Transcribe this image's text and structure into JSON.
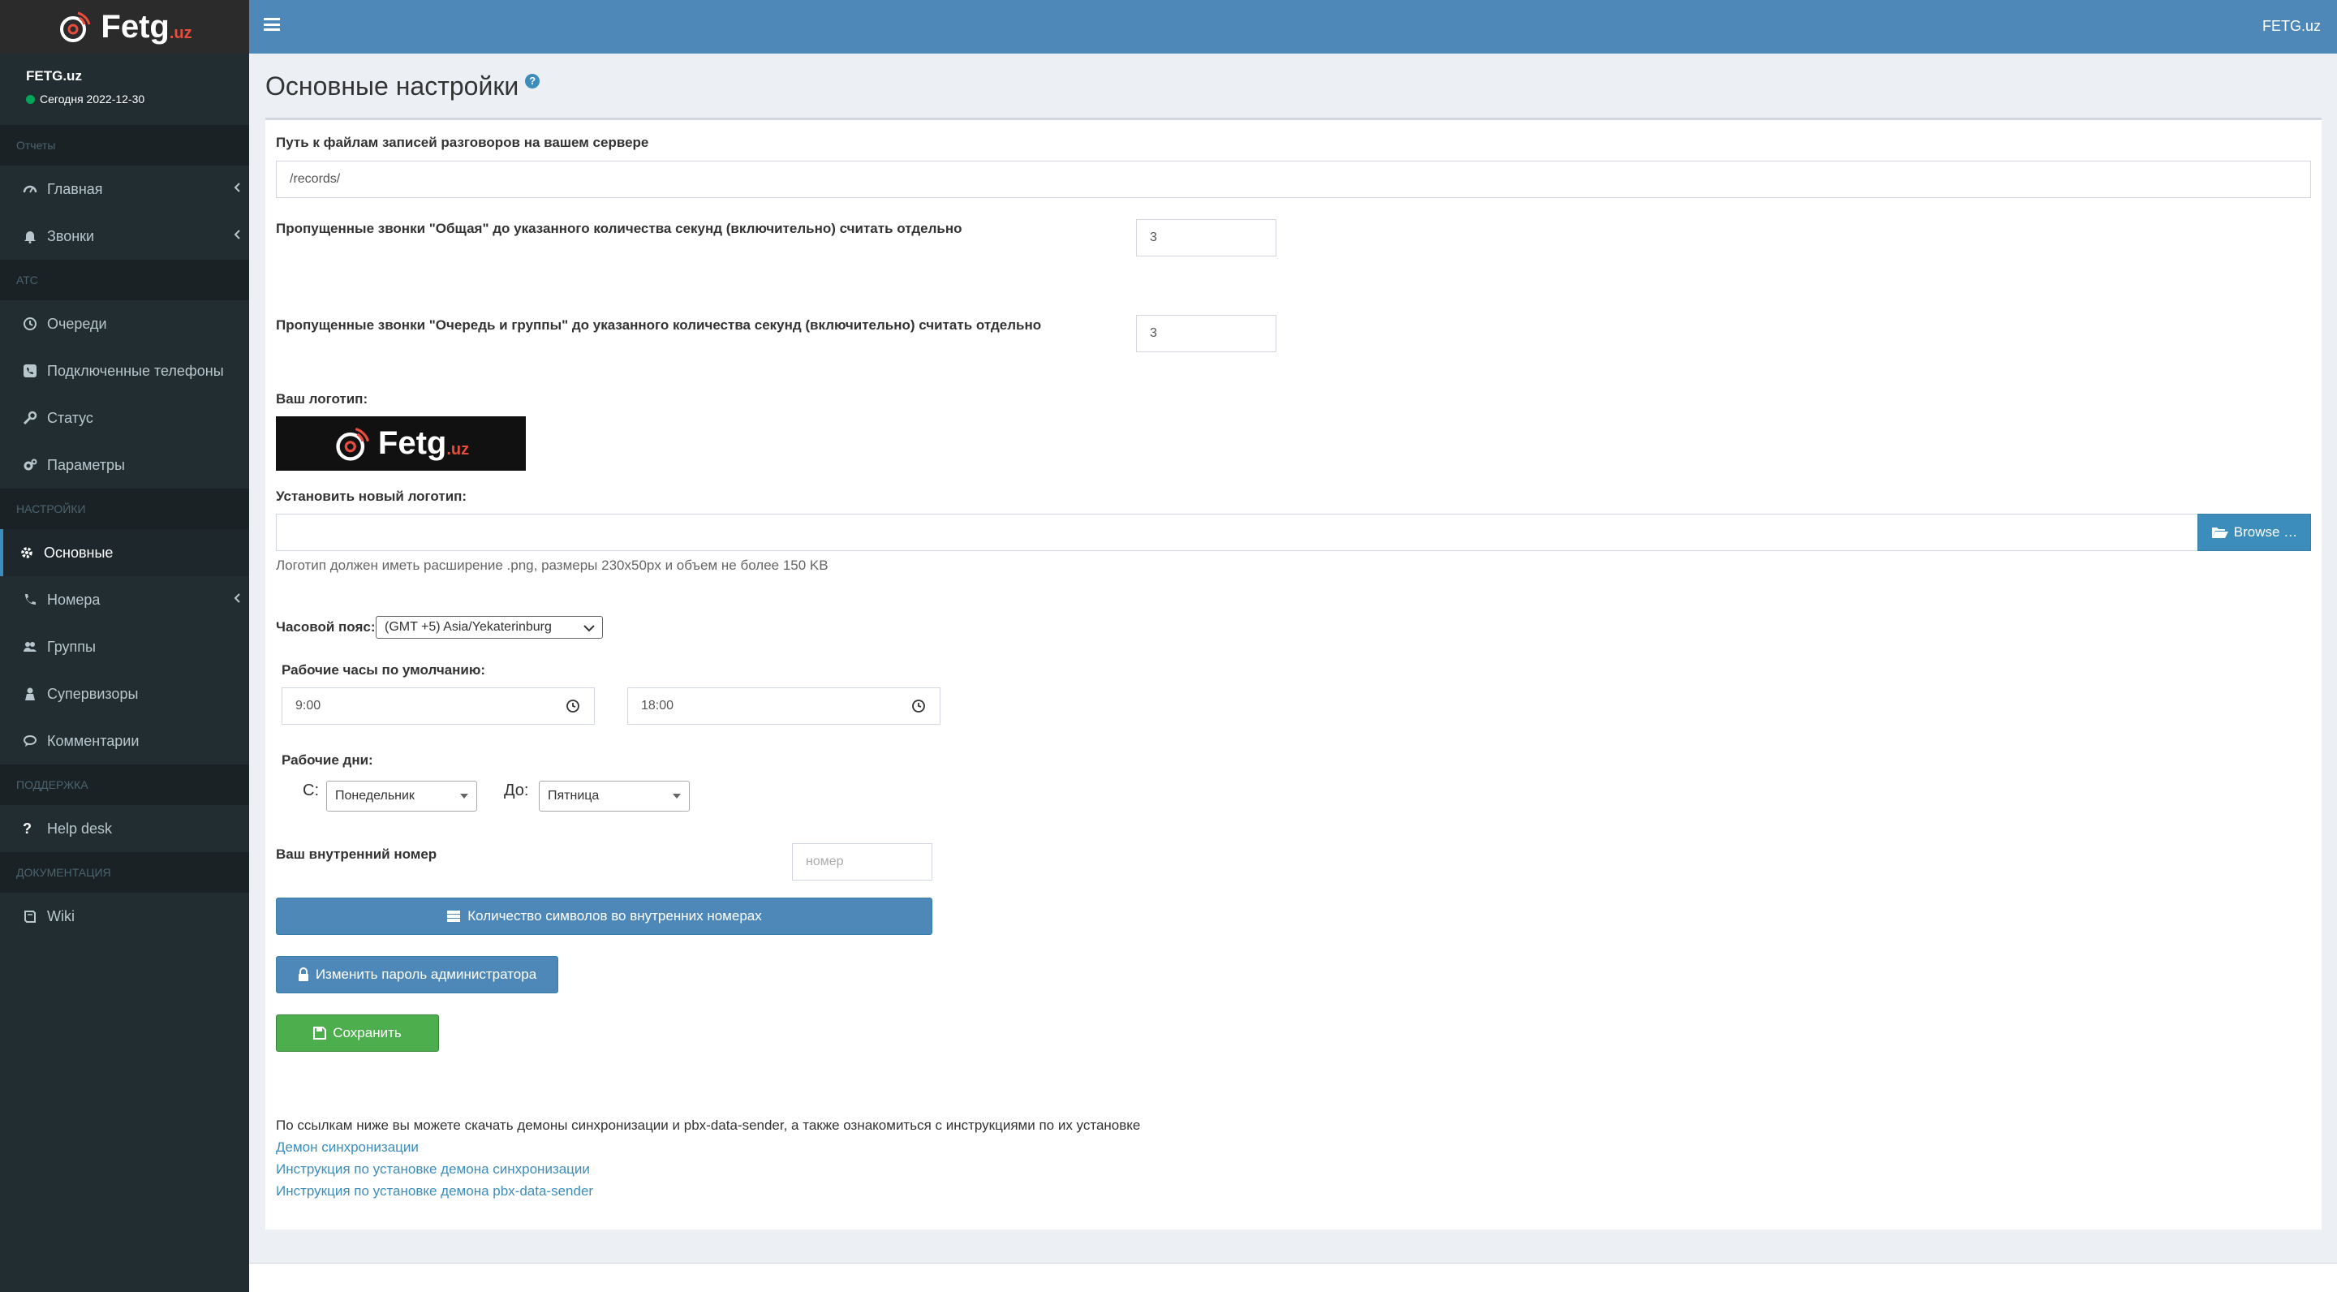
{
  "app": {
    "brand_main": "Fetg",
    "brand_suffix": ".uz",
    "topbar_brand": "FETG.uz"
  },
  "user": {
    "name": "FETG.uz",
    "status": "Сегодня 2022-12-30"
  },
  "sidebar": {
    "sections": [
      {
        "label": "Отчеты"
      },
      {
        "label": "АТС"
      },
      {
        "label": "НАСТРОЙКИ"
      },
      {
        "label": "ПОДДЕРЖКА"
      },
      {
        "label": "ДОКУМЕНТАЦИЯ"
      }
    ],
    "items": [
      {
        "label": "Главная",
        "icon": "dashboard-icon"
      },
      {
        "label": "Звонки",
        "icon": "bell-icon"
      },
      {
        "label": "Очереди",
        "icon": "clock-icon"
      },
      {
        "label": "Подключенные телефоны",
        "icon": "phone-square-icon"
      },
      {
        "label": "Статус",
        "icon": "wrench-icon"
      },
      {
        "label": "Параметры",
        "icon": "cogs-icon"
      },
      {
        "label": "Основные",
        "icon": "gear-icon"
      },
      {
        "label": "Номера",
        "icon": "phone-icon"
      },
      {
        "label": "Группы",
        "icon": "users-icon"
      },
      {
        "label": "Супервизоры",
        "icon": "user-secret-icon"
      },
      {
        "label": "Комментарии",
        "icon": "comments-icon"
      },
      {
        "label": "Help desk",
        "icon": "question-icon"
      },
      {
        "label": "Wiki",
        "icon": "book-icon"
      }
    ]
  },
  "page": {
    "title": "Основные настройки"
  },
  "form": {
    "records_path_label": "Путь к файлам записей разговоров на вашем сервере",
    "records_path_value": "/records/",
    "missed_general_label": "Пропущенные звонки \"Общая\" до указанного количества секунд (включительно) считать отдельно",
    "missed_general_value": "3",
    "missed_queue_label": "Пропущенные звонки \"Очередь и группы\" до указанного количества секунд (включительно) считать отдельно",
    "missed_queue_value": "3",
    "logo_label": "Ваш логотип:",
    "new_logo_label": "Установить новый логотип:",
    "browse_label": "Browse …",
    "logo_hint": "Логотип должен иметь расширение .png, размеры 230x50px и объем не более 150 KB",
    "timezone_label": "Часовой пояс:",
    "timezone_value": "(GMT +5) Asia/Yekaterinburg",
    "work_hours_label": "Рабочие часы по умолчанию:",
    "work_hours_from": "9:00",
    "work_hours_to": "18:00",
    "work_days_label": "Рабочие дни:",
    "from_label": "С:",
    "from_day": "Понедельник",
    "to_label": "До:",
    "to_day": "Пятница",
    "internal_number_label": "Ваш внутренний номер",
    "internal_number_placeholder": "номер",
    "digits_button": "Количество символов во внутренних номерах",
    "change_password_button": "Изменить пароль администратора",
    "save_button": "Сохранить"
  },
  "downloads": {
    "intro": "По ссылкам ниже вы можете скачать демоны синхронизации и pbx-data-sender, а также ознакомиться с инструкциями по их установке",
    "links": [
      "Демон синхронизации",
      "Инструкция по установке демона синхронизации",
      "Инструкция по установке демона pbx-data-sender"
    ]
  },
  "colors": {
    "sidebar": "#222d32",
    "topbar": "#4e88b9",
    "primary": "#3c8dbc",
    "success": "#4cae4c"
  }
}
